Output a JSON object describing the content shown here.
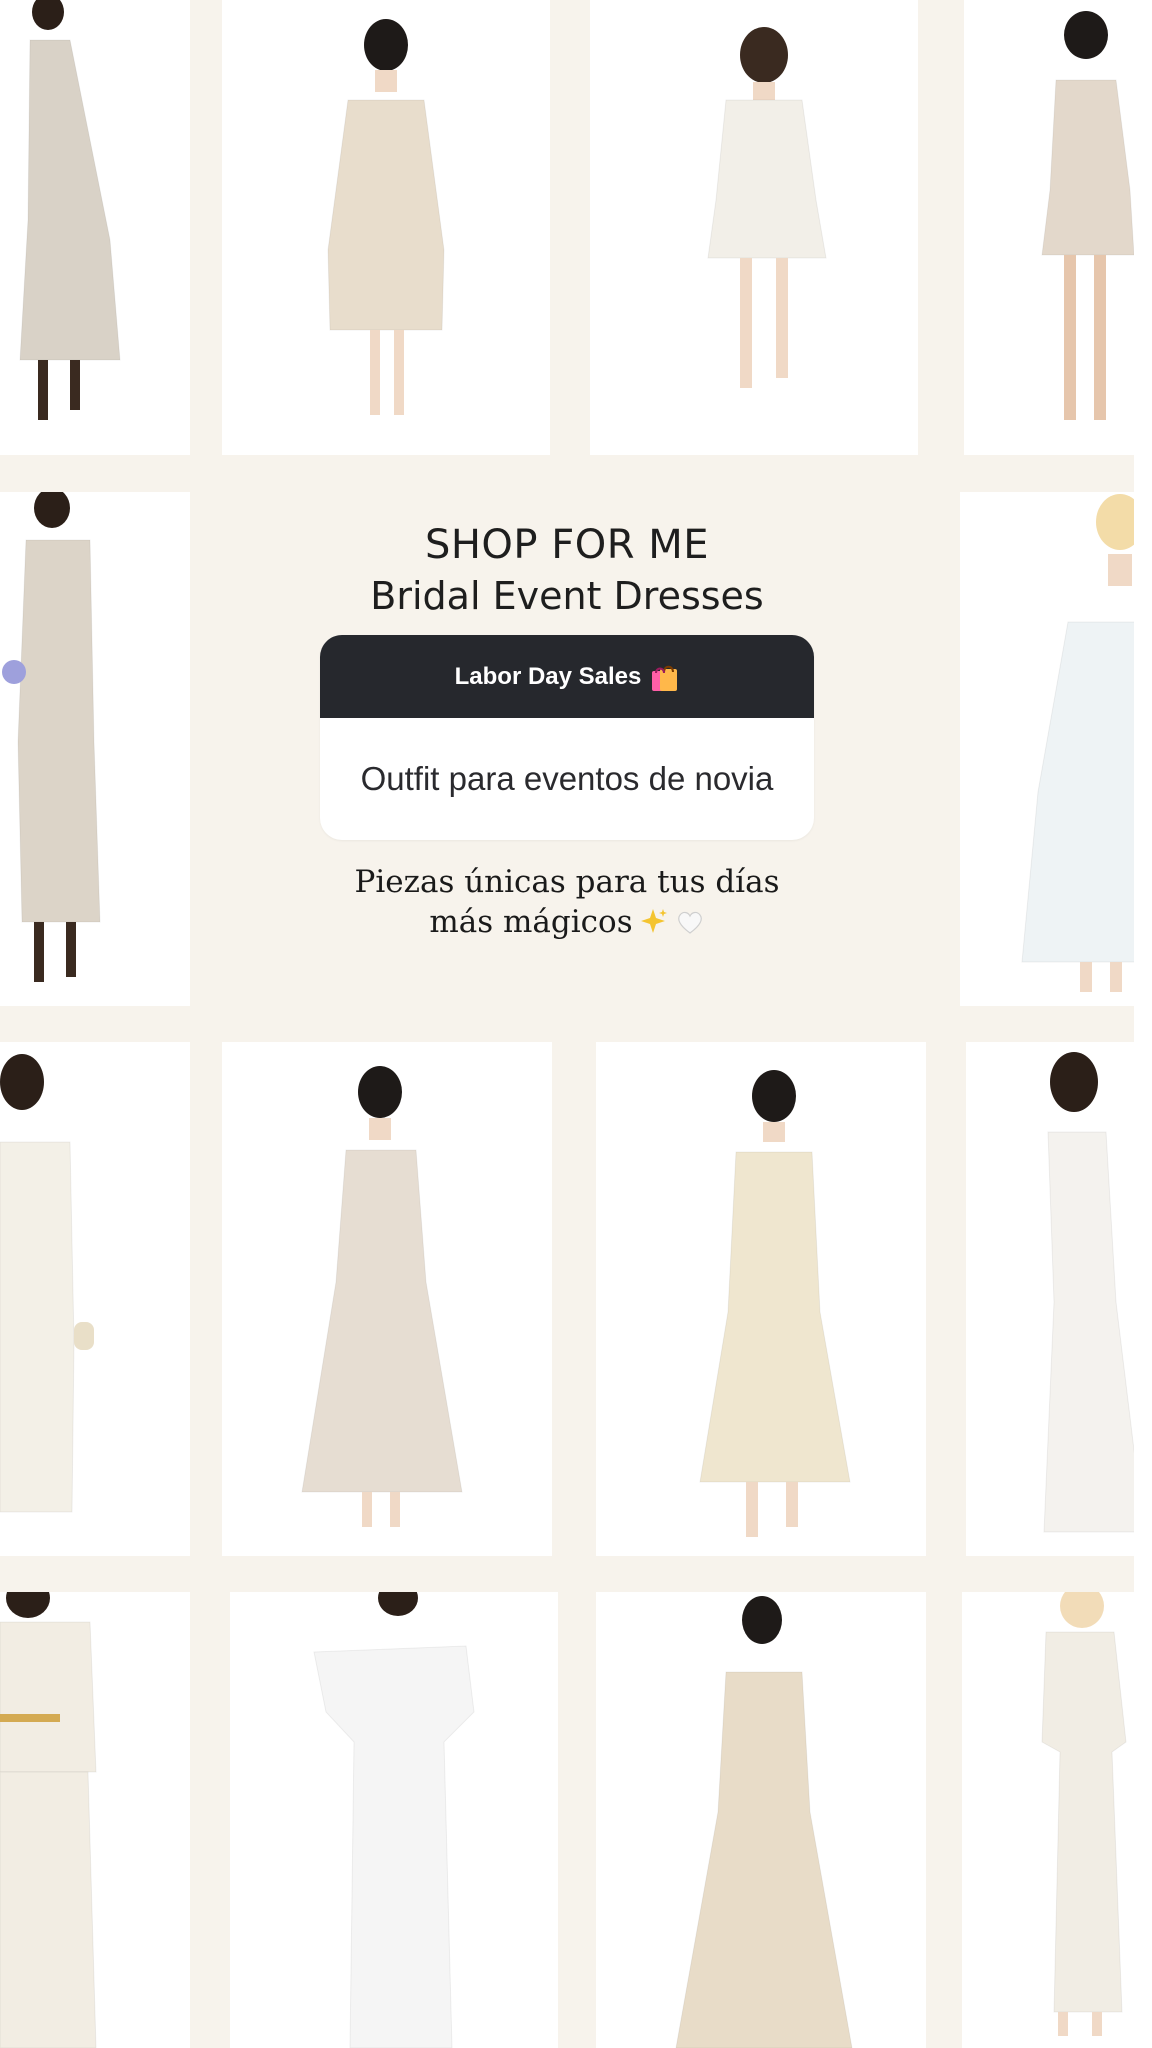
{
  "title": {
    "line1": "SHOP FOR ME",
    "line2": "Bridal Event Dresses"
  },
  "sticker": {
    "header": "Labor Day Sales",
    "header_icon": "shopping-bags-icon",
    "body": "Outfit para eventos de novia"
  },
  "subtitle": {
    "line1": "Piezas únicas para tus días",
    "line2": "más mágicos",
    "icons": [
      "sparkles-icon",
      "white-heart-icon"
    ]
  },
  "colors": {
    "background": "#f7f3ec",
    "tile_background": "#ffffff",
    "sticker_header": "#26282d",
    "text_dark": "#1e1e1e"
  },
  "products": [
    {
      "name": "product-1",
      "dress_color": "#d9d2c7"
    },
    {
      "name": "product-2",
      "dress_color": "#e8ddcc"
    },
    {
      "name": "product-3",
      "dress_color": "#f2efe8"
    },
    {
      "name": "product-4",
      "dress_color": "#e3d8cb"
    },
    {
      "name": "product-5",
      "dress_color": "#dcd4c8"
    },
    {
      "name": "product-6",
      "dress_color": "#eef3f5"
    },
    {
      "name": "product-7",
      "dress_color": "#f3f0e7"
    },
    {
      "name": "product-8",
      "dress_color": "#e6ddd2"
    },
    {
      "name": "product-9",
      "dress_color": "#efe6cf"
    },
    {
      "name": "product-10",
      "dress_color": "#f4f2ee"
    },
    {
      "name": "product-11",
      "dress_color": "#f2ede3"
    },
    {
      "name": "product-12",
      "dress_color": "#f5f5f5"
    },
    {
      "name": "product-13",
      "dress_color": "#e8dcc8"
    },
    {
      "name": "product-14",
      "dress_color": "#f1ede4"
    }
  ]
}
